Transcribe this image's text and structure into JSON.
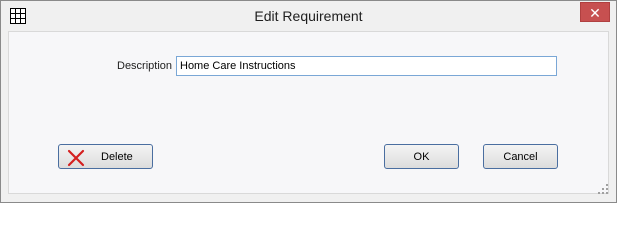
{
  "window": {
    "title": "Edit Requirement",
    "close_glyph": "✕"
  },
  "form": {
    "description_label": "Description",
    "description_value": "Home Care Instructions"
  },
  "buttons": {
    "delete_label": "Delete",
    "ok_label": "OK",
    "cancel_label": "Cancel"
  },
  "icons": {
    "app": "grid-icon",
    "delete": "red-x-icon"
  },
  "colors": {
    "close_button": "#c75050",
    "delete_icon": "#d42020",
    "input_border": "#7aa7d6"
  }
}
